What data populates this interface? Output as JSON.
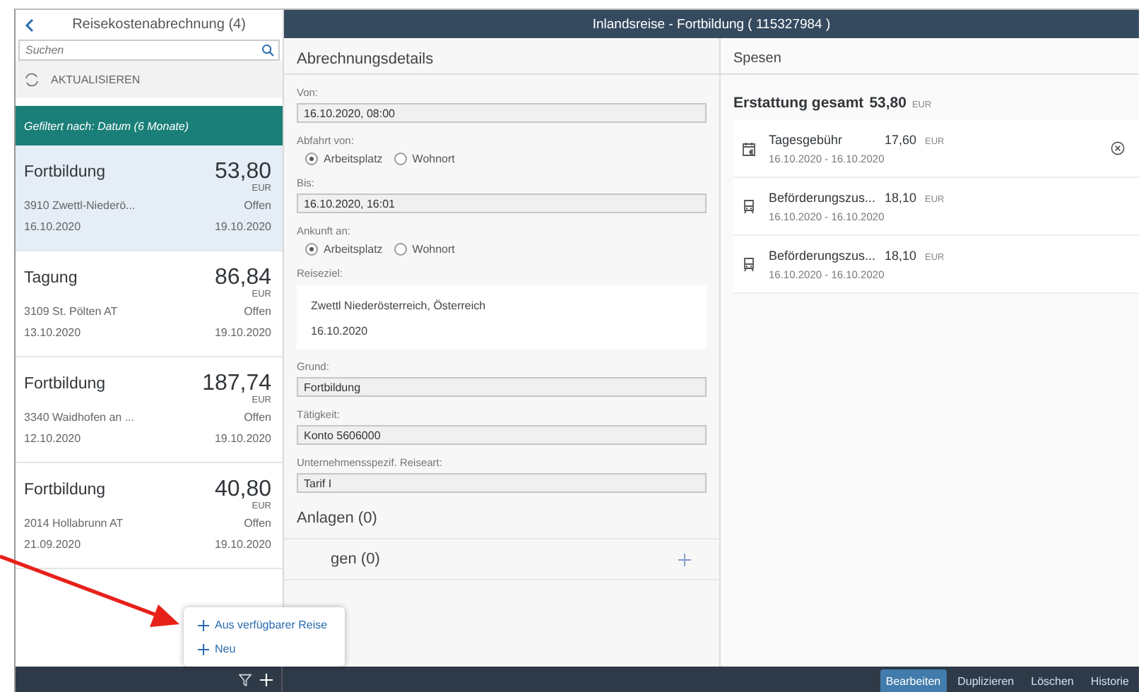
{
  "master": {
    "title": "Reisekostenabrechnung (4)",
    "search": {
      "placeholder": "Suchen"
    },
    "refresh": "AKTUALISIEREN",
    "filter_info": "Gefiltert nach: Datum (6 Monate)",
    "items": [
      {
        "title": "Fortbildung",
        "amount": "53,80",
        "currency": "EUR",
        "location": "3910 Zwettl-Niederö...",
        "status": "Offen",
        "date_from": "16.10.2020",
        "date_to": "19.10.2020",
        "selected": true
      },
      {
        "title": "Tagung",
        "amount": "86,84",
        "currency": "EUR",
        "location": "3109 St. Pölten AT",
        "status": "Offen",
        "date_from": "13.10.2020",
        "date_to": "19.10.2020",
        "selected": false
      },
      {
        "title": "Fortbildung",
        "amount": "187,74",
        "currency": "EUR",
        "location": "3340 Waidhofen an ...",
        "status": "Offen",
        "date_from": "12.10.2020",
        "date_to": "19.10.2020",
        "selected": false
      },
      {
        "title": "Fortbildung",
        "amount": "40,80",
        "currency": "EUR",
        "location": "2014 Hollabrunn AT",
        "status": "Offen",
        "date_from": "21.09.2020",
        "date_to": "19.10.2020",
        "selected": false
      }
    ]
  },
  "header": {
    "title": "Inlandsreise - Fortbildung ( 115327984 )"
  },
  "details": {
    "title": "Abrechnungsdetails",
    "fields": [
      {
        "kind": "input",
        "label": "Von:",
        "value": "16.10.2020, 08:00"
      },
      {
        "kind": "radio",
        "label": "Abfahrt von:",
        "options": [
          {
            "label": "Arbeitsplatz",
            "selected": true
          },
          {
            "label": "Wohnort",
            "selected": false
          }
        ]
      },
      {
        "kind": "input",
        "label": "Bis:",
        "value": "16.10.2020, 16:01"
      },
      {
        "kind": "radio",
        "label": "Ankunft an:",
        "options": [
          {
            "label": "Arbeitsplatz",
            "selected": true
          },
          {
            "label": "Wohnort",
            "selected": false
          }
        ]
      },
      {
        "kind": "card",
        "label": "Reiseziel:",
        "lines": [
          "Zwettl Niederösterreich, Österreich",
          "16.10.2020"
        ]
      },
      {
        "kind": "input",
        "label": "Grund:",
        "value": "Fortbildung"
      },
      {
        "kind": "input",
        "label": "Tätigkeit:",
        "value": "Konto 5606000"
      },
      {
        "kind": "input",
        "label": "Unternehmensspezif. Reiseart:",
        "value": "Tarif I"
      }
    ]
  },
  "sections": [
    {
      "kind": "plain",
      "title": "Anlagen (0)"
    },
    {
      "kind": "addable",
      "title": "gen (0)"
    }
  ],
  "expenses": {
    "title": "Spesen",
    "total_label": "Erstattung gesamt",
    "total_amount": "53,80",
    "total_currency": "EUR",
    "items": [
      {
        "kind": "daily",
        "name": "Tagesgebühr",
        "amount": "17,60",
        "currency": "EUR",
        "dates": "16.10.2020 - 16.10.2020",
        "removable": true
      },
      {
        "kind": "transport",
        "name": "Beförderungszus...",
        "amount": "18,10",
        "currency": "EUR",
        "dates": "16.10.2020 - 16.10.2020",
        "removable": false
      },
      {
        "kind": "transport",
        "name": "Beförderungszus...",
        "amount": "18,10",
        "currency": "EUR",
        "dates": "16.10.2020 - 16.10.2020",
        "removable": false
      }
    ]
  },
  "popup": {
    "items": [
      "Aus verfügbarer Reise",
      "Neu"
    ]
  },
  "footer": {
    "actions": [
      {
        "label": "Bearbeiten",
        "emphasized": true
      },
      {
        "label": "Duplizieren",
        "emphasized": false
      },
      {
        "label": "Löschen",
        "emphasized": false
      },
      {
        "label": "Historie",
        "emphasized": false
      }
    ]
  }
}
